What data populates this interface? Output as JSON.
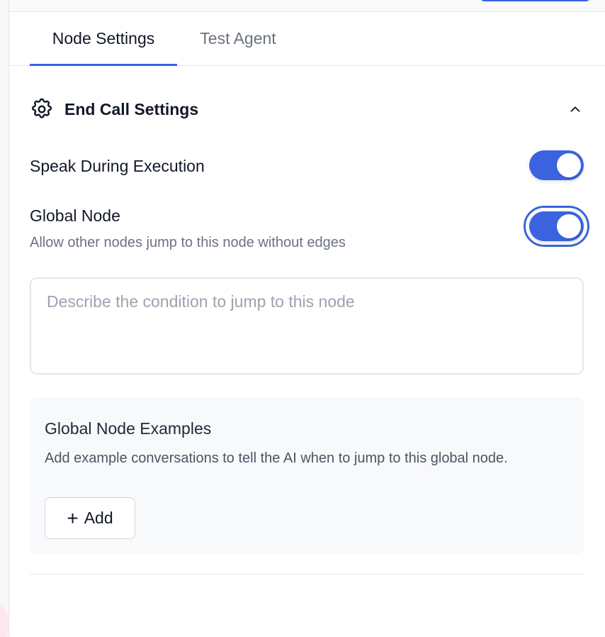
{
  "tabs": [
    {
      "label": "Node Settings",
      "active": true
    },
    {
      "label": "Test Agent",
      "active": false
    }
  ],
  "section": {
    "title": "End Call Settings",
    "icon": "gear-icon",
    "collapse_icon": "chevron-up-icon",
    "expanded": true
  },
  "speak_during_execution": {
    "label": "Speak During Execution",
    "enabled": true
  },
  "global_node": {
    "label": "Global Node",
    "description": "Allow other nodes jump to this node without edges",
    "enabled": true,
    "condition_value": "",
    "condition_placeholder": "Describe the condition to jump to this node"
  },
  "examples": {
    "title": "Global Node Examples",
    "description": "Add example conversations to tell the AI when to jump to this global node.",
    "add_icon": "+",
    "add_label": "Add"
  },
  "colors": {
    "accent": "#3b63e0",
    "muted_text": "#6b7280",
    "border": "#e5e7eb",
    "panel_bg": "#f8f9fb"
  }
}
